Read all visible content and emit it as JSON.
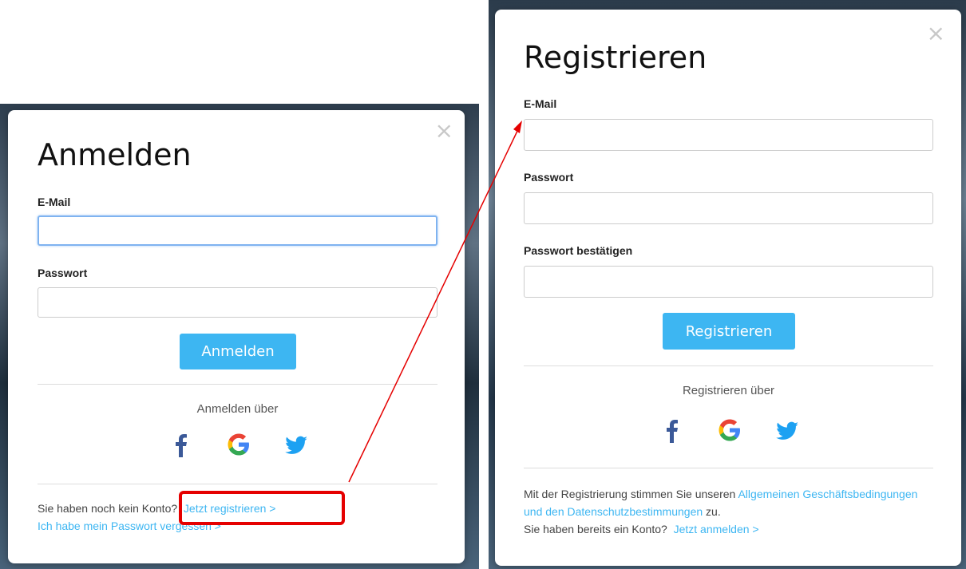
{
  "login": {
    "title": "Anmelden",
    "email_label": "E-Mail",
    "email_value": "",
    "password_label": "Passwort",
    "password_value": "",
    "submit_label": "Anmelden",
    "social_heading": "Anmelden über",
    "no_account_text": "Sie haben noch kein Konto?",
    "register_link": "Jetzt registrieren >",
    "forgot_link": "Ich habe mein Passwort vergessen >",
    "close_symbol": "×"
  },
  "register": {
    "title": "Registrieren",
    "email_label": "E-Mail",
    "email_value": "",
    "password_label": "Passwort",
    "password_value": "",
    "confirm_label": "Passwort bestätigen",
    "confirm_value": "",
    "submit_label": "Registrieren",
    "social_heading": "Registrieren über",
    "terms_prefix": "Mit der Registrierung stimmen Sie unseren",
    "terms_link": "Allgemeinen Geschäftsbedingungen und den Datenschutzbestimmungen",
    "terms_suffix": "zu.",
    "have_account_text": "Sie haben bereits ein Konto?",
    "login_link": "Jetzt anmelden >",
    "close_symbol": "×"
  },
  "icons": {
    "facebook": "facebook-icon",
    "google": "google-icon",
    "twitter": "twitter-icon"
  },
  "colors": {
    "accent": "#3db6f2",
    "annotation": "#e50000",
    "facebook": "#3b5998",
    "twitter": "#1da1f2"
  }
}
